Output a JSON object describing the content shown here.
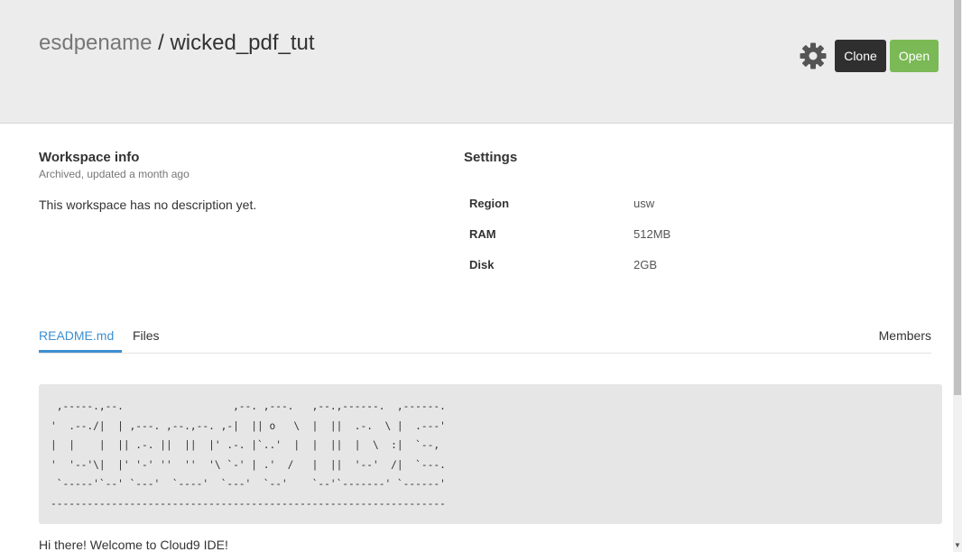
{
  "header": {
    "owner": "esdpename",
    "separator": " / ",
    "workspace_name": "wicked_pdf_tut",
    "clone_label": "Clone",
    "open_label": "Open"
  },
  "workspace_info": {
    "title": "Workspace info",
    "status": "Archived, updated a month ago",
    "description": "This workspace has no description yet."
  },
  "settings": {
    "title": "Settings",
    "rows": [
      {
        "label": "Region",
        "value": "usw"
      },
      {
        "label": "RAM",
        "value": "512MB"
      },
      {
        "label": "Disk",
        "value": "2GB"
      }
    ]
  },
  "tabs": {
    "readme": "README.md",
    "files": "Files",
    "members": "Members"
  },
  "readme": {
    "ascii_art": " ,-----.,--.                  ,--. ,---.   ,--.,------.  ,------.\n'  .--./|  | ,---. ,--.,--. ,-|  || o   \\  |  ||  .-.  \\ |  .---'\n|  |    |  || .-. ||  ||  |' .-. |`..'  |  |  ||  |  \\  :|  `--,\n'  '--'\\|  |' '-' ''  ''  '\\ `-' | .'  /   |  ||  '--'  /|  `---.\n `-----'`--' `---'  `----'  `---'  `--'    `--'`-------' `------'\n-----------------------------------------------------------------",
    "welcome": "Hi there! Welcome to Cloud9 IDE!"
  },
  "colors": {
    "header_bg": "#ececec",
    "clone_bg": "#2f2f2f",
    "open_bg": "#7ab956",
    "active_tab": "#3d8fd1"
  },
  "icons": {
    "settings": "gear-icon"
  }
}
